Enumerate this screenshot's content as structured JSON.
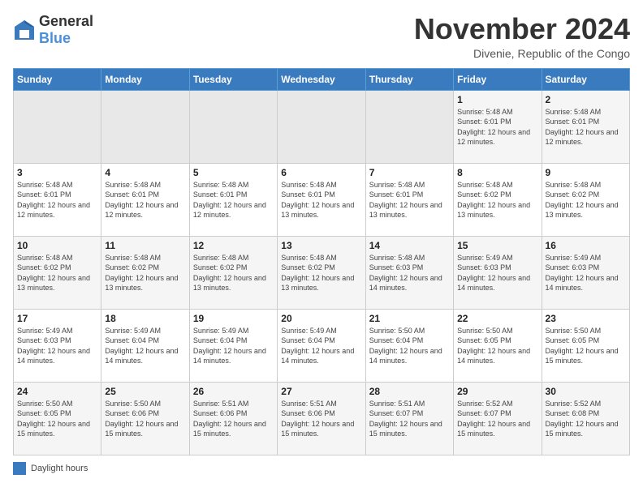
{
  "header": {
    "logo_general": "General",
    "logo_blue": "Blue",
    "month": "November 2024",
    "location": "Divenie, Republic of the Congo"
  },
  "legend": {
    "box_color": "#3a7bbf",
    "label": "Daylight hours"
  },
  "days_of_week": [
    "Sunday",
    "Monday",
    "Tuesday",
    "Wednesday",
    "Thursday",
    "Friday",
    "Saturday"
  ],
  "weeks": [
    [
      {
        "day": "",
        "sunrise": "",
        "sunset": "",
        "daylight": ""
      },
      {
        "day": "",
        "sunrise": "",
        "sunset": "",
        "daylight": ""
      },
      {
        "day": "",
        "sunrise": "",
        "sunset": "",
        "daylight": ""
      },
      {
        "day": "",
        "sunrise": "",
        "sunset": "",
        "daylight": ""
      },
      {
        "day": "",
        "sunrise": "",
        "sunset": "",
        "daylight": ""
      },
      {
        "day": "1",
        "sunrise": "Sunrise: 5:48 AM",
        "sunset": "Sunset: 6:01 PM",
        "daylight": "Daylight: 12 hours and 12 minutes."
      },
      {
        "day": "2",
        "sunrise": "Sunrise: 5:48 AM",
        "sunset": "Sunset: 6:01 PM",
        "daylight": "Daylight: 12 hours and 12 minutes."
      }
    ],
    [
      {
        "day": "3",
        "sunrise": "Sunrise: 5:48 AM",
        "sunset": "Sunset: 6:01 PM",
        "daylight": "Daylight: 12 hours and 12 minutes."
      },
      {
        "day": "4",
        "sunrise": "Sunrise: 5:48 AM",
        "sunset": "Sunset: 6:01 PM",
        "daylight": "Daylight: 12 hours and 12 minutes."
      },
      {
        "day": "5",
        "sunrise": "Sunrise: 5:48 AM",
        "sunset": "Sunset: 6:01 PM",
        "daylight": "Daylight: 12 hours and 12 minutes."
      },
      {
        "day": "6",
        "sunrise": "Sunrise: 5:48 AM",
        "sunset": "Sunset: 6:01 PM",
        "daylight": "Daylight: 12 hours and 13 minutes."
      },
      {
        "day": "7",
        "sunrise": "Sunrise: 5:48 AM",
        "sunset": "Sunset: 6:01 PM",
        "daylight": "Daylight: 12 hours and 13 minutes."
      },
      {
        "day": "8",
        "sunrise": "Sunrise: 5:48 AM",
        "sunset": "Sunset: 6:02 PM",
        "daylight": "Daylight: 12 hours and 13 minutes."
      },
      {
        "day": "9",
        "sunrise": "Sunrise: 5:48 AM",
        "sunset": "Sunset: 6:02 PM",
        "daylight": "Daylight: 12 hours and 13 minutes."
      }
    ],
    [
      {
        "day": "10",
        "sunrise": "Sunrise: 5:48 AM",
        "sunset": "Sunset: 6:02 PM",
        "daylight": "Daylight: 12 hours and 13 minutes."
      },
      {
        "day": "11",
        "sunrise": "Sunrise: 5:48 AM",
        "sunset": "Sunset: 6:02 PM",
        "daylight": "Daylight: 12 hours and 13 minutes."
      },
      {
        "day": "12",
        "sunrise": "Sunrise: 5:48 AM",
        "sunset": "Sunset: 6:02 PM",
        "daylight": "Daylight: 12 hours and 13 minutes."
      },
      {
        "day": "13",
        "sunrise": "Sunrise: 5:48 AM",
        "sunset": "Sunset: 6:02 PM",
        "daylight": "Daylight: 12 hours and 13 minutes."
      },
      {
        "day": "14",
        "sunrise": "Sunrise: 5:48 AM",
        "sunset": "Sunset: 6:03 PM",
        "daylight": "Daylight: 12 hours and 14 minutes."
      },
      {
        "day": "15",
        "sunrise": "Sunrise: 5:49 AM",
        "sunset": "Sunset: 6:03 PM",
        "daylight": "Daylight: 12 hours and 14 minutes."
      },
      {
        "day": "16",
        "sunrise": "Sunrise: 5:49 AM",
        "sunset": "Sunset: 6:03 PM",
        "daylight": "Daylight: 12 hours and 14 minutes."
      }
    ],
    [
      {
        "day": "17",
        "sunrise": "Sunrise: 5:49 AM",
        "sunset": "Sunset: 6:03 PM",
        "daylight": "Daylight: 12 hours and 14 minutes."
      },
      {
        "day": "18",
        "sunrise": "Sunrise: 5:49 AM",
        "sunset": "Sunset: 6:04 PM",
        "daylight": "Daylight: 12 hours and 14 minutes."
      },
      {
        "day": "19",
        "sunrise": "Sunrise: 5:49 AM",
        "sunset": "Sunset: 6:04 PM",
        "daylight": "Daylight: 12 hours and 14 minutes."
      },
      {
        "day": "20",
        "sunrise": "Sunrise: 5:49 AM",
        "sunset": "Sunset: 6:04 PM",
        "daylight": "Daylight: 12 hours and 14 minutes."
      },
      {
        "day": "21",
        "sunrise": "Sunrise: 5:50 AM",
        "sunset": "Sunset: 6:04 PM",
        "daylight": "Daylight: 12 hours and 14 minutes."
      },
      {
        "day": "22",
        "sunrise": "Sunrise: 5:50 AM",
        "sunset": "Sunset: 6:05 PM",
        "daylight": "Daylight: 12 hours and 14 minutes."
      },
      {
        "day": "23",
        "sunrise": "Sunrise: 5:50 AM",
        "sunset": "Sunset: 6:05 PM",
        "daylight": "Daylight: 12 hours and 15 minutes."
      }
    ],
    [
      {
        "day": "24",
        "sunrise": "Sunrise: 5:50 AM",
        "sunset": "Sunset: 6:05 PM",
        "daylight": "Daylight: 12 hours and 15 minutes."
      },
      {
        "day": "25",
        "sunrise": "Sunrise: 5:50 AM",
        "sunset": "Sunset: 6:06 PM",
        "daylight": "Daylight: 12 hours and 15 minutes."
      },
      {
        "day": "26",
        "sunrise": "Sunrise: 5:51 AM",
        "sunset": "Sunset: 6:06 PM",
        "daylight": "Daylight: 12 hours and 15 minutes."
      },
      {
        "day": "27",
        "sunrise": "Sunrise: 5:51 AM",
        "sunset": "Sunset: 6:06 PM",
        "daylight": "Daylight: 12 hours and 15 minutes."
      },
      {
        "day": "28",
        "sunrise": "Sunrise: 5:51 AM",
        "sunset": "Sunset: 6:07 PM",
        "daylight": "Daylight: 12 hours and 15 minutes."
      },
      {
        "day": "29",
        "sunrise": "Sunrise: 5:52 AM",
        "sunset": "Sunset: 6:07 PM",
        "daylight": "Daylight: 12 hours and 15 minutes."
      },
      {
        "day": "30",
        "sunrise": "Sunrise: 5:52 AM",
        "sunset": "Sunset: 6:08 PM",
        "daylight": "Daylight: 12 hours and 15 minutes."
      }
    ]
  ]
}
